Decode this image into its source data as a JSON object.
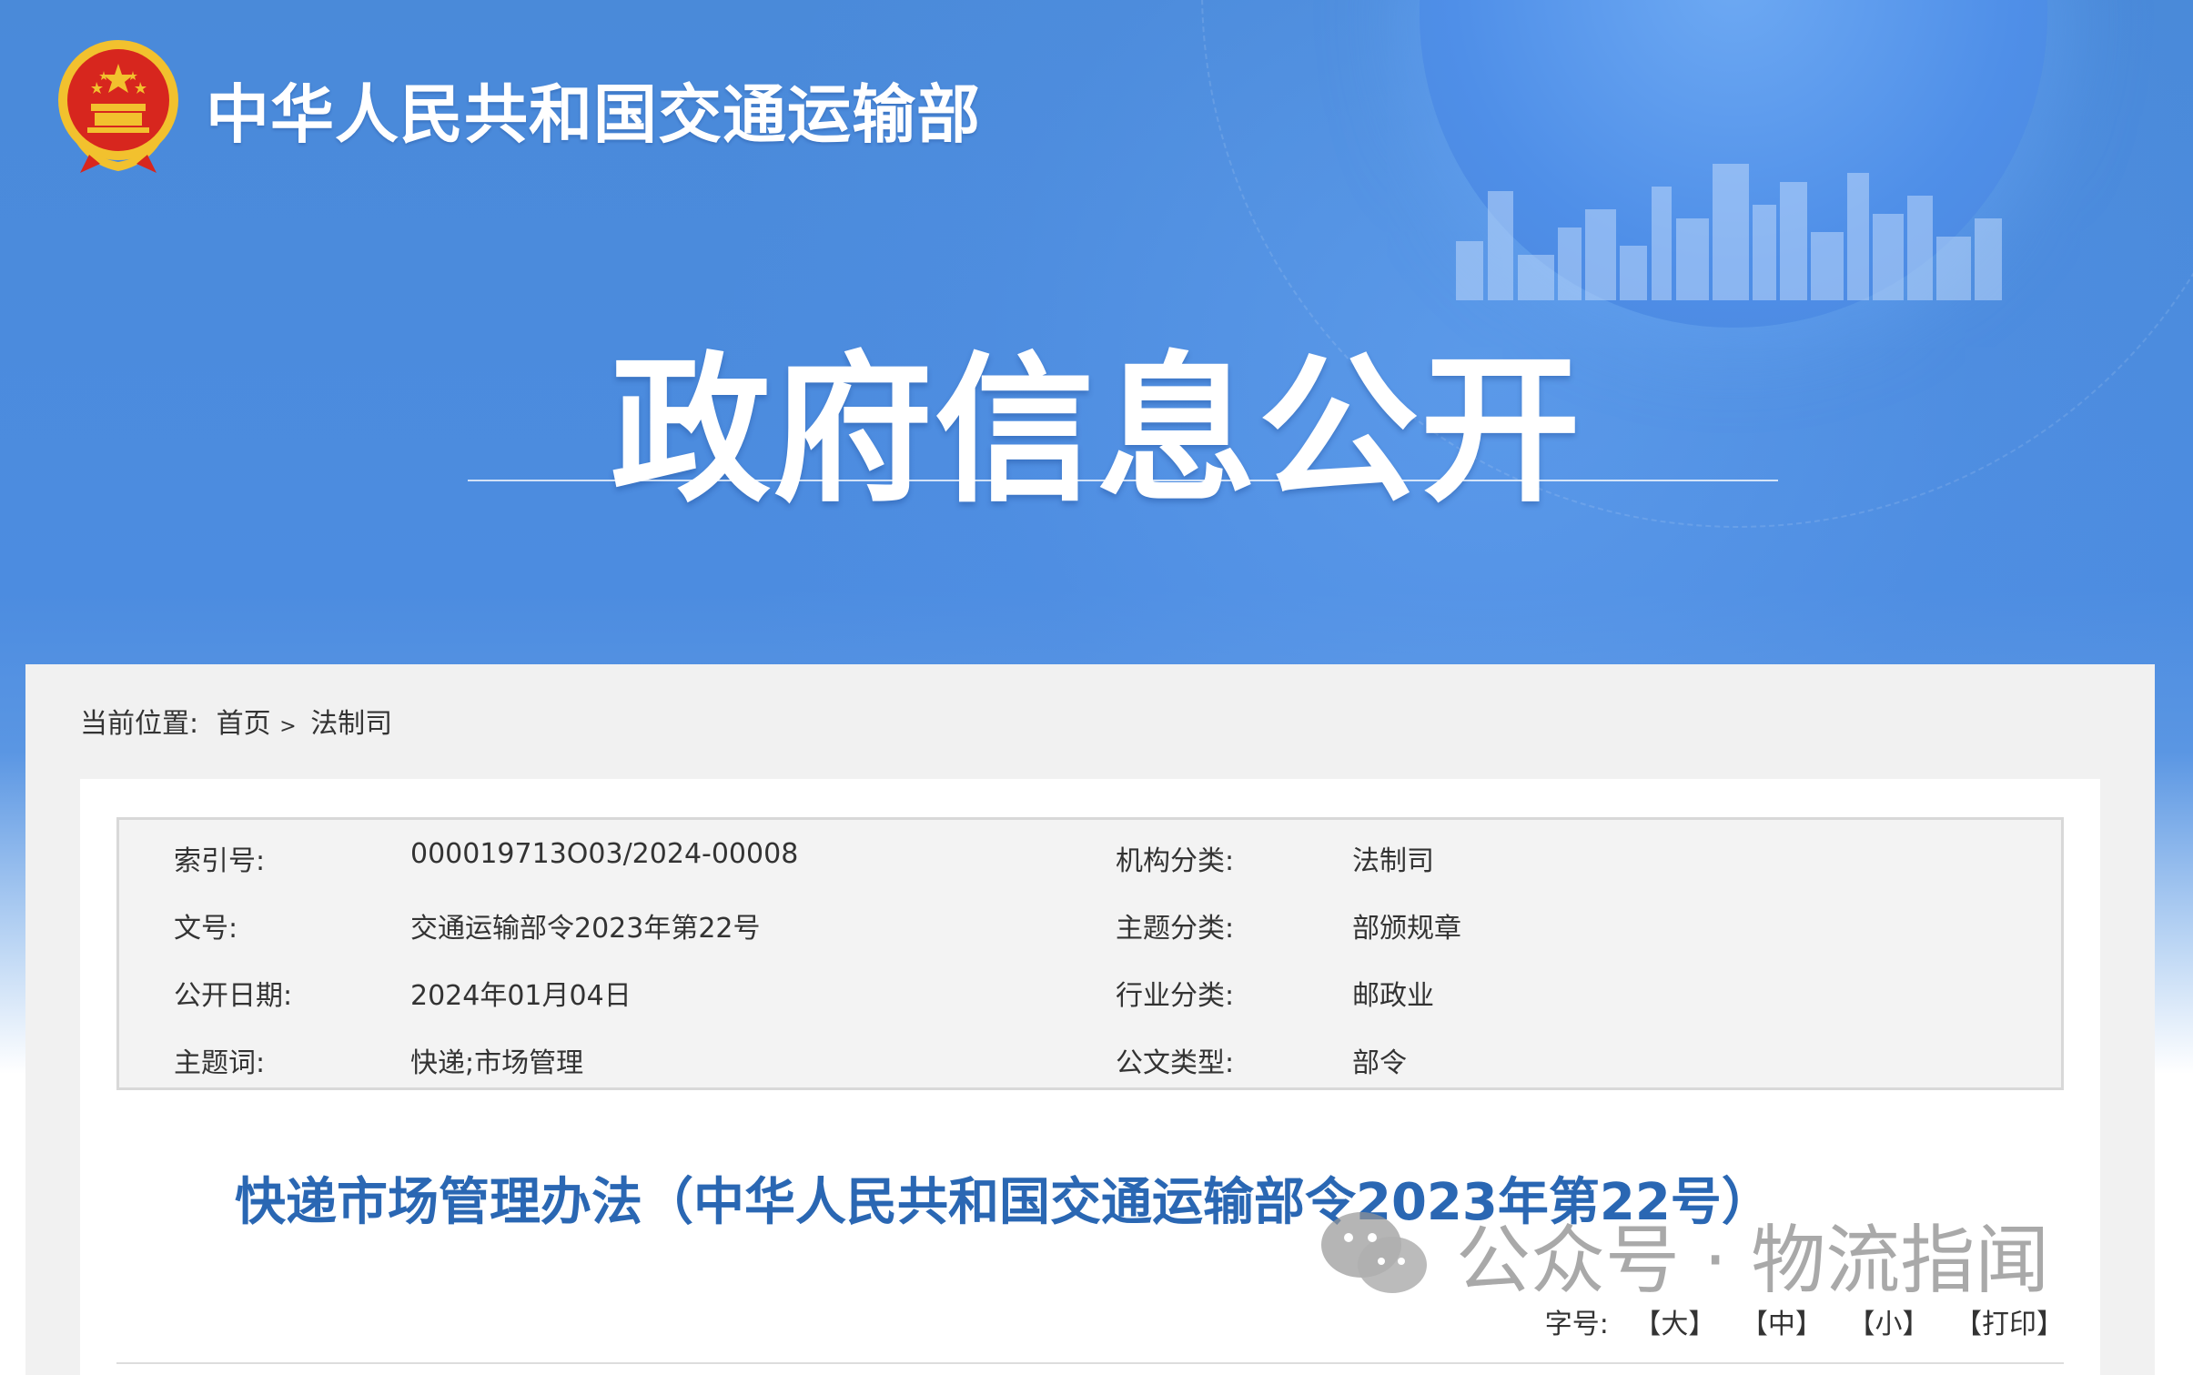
{
  "header": {
    "ministry_name": "中华人民共和国交通运输部",
    "section_title": "政府信息公开"
  },
  "breadcrumb": {
    "label": "当前位置:",
    "items": [
      "首页",
      "法制司"
    ],
    "separator": ">"
  },
  "metadata": {
    "rows": [
      {
        "label_left": "索引号:",
        "value_left": "000019713O03/2024-00008",
        "label_right": "机构分类:",
        "value_right": "法制司"
      },
      {
        "label_left": "文号:",
        "value_left": "交通运输部令2023年第22号",
        "label_right": "主题分类:",
        "value_right": "部颁规章"
      },
      {
        "label_left": "公开日期:",
        "value_left": "2024年01月04日",
        "label_right": "行业分类:",
        "value_right": "邮政业"
      },
      {
        "label_left": "主题词:",
        "value_left": "快递;市场管理",
        "label_right": "公文类型:",
        "value_right": "部令"
      }
    ]
  },
  "document": {
    "title": "快递市场管理办法（中华人民共和国交通运输部令2023年第22号）"
  },
  "font_size_bar": {
    "label": "字号:",
    "options": [
      "【大】",
      "【中】",
      "【小】",
      "【打印】"
    ]
  },
  "watermark": {
    "text": "公众号 · 物流指闻",
    "icon": "wechat-icon"
  },
  "colors": {
    "banner_blue": "#4a8ad9",
    "title_blue": "#2a67b3",
    "emblem_red": "#d7261e",
    "emblem_gold": "#f2c12e"
  }
}
